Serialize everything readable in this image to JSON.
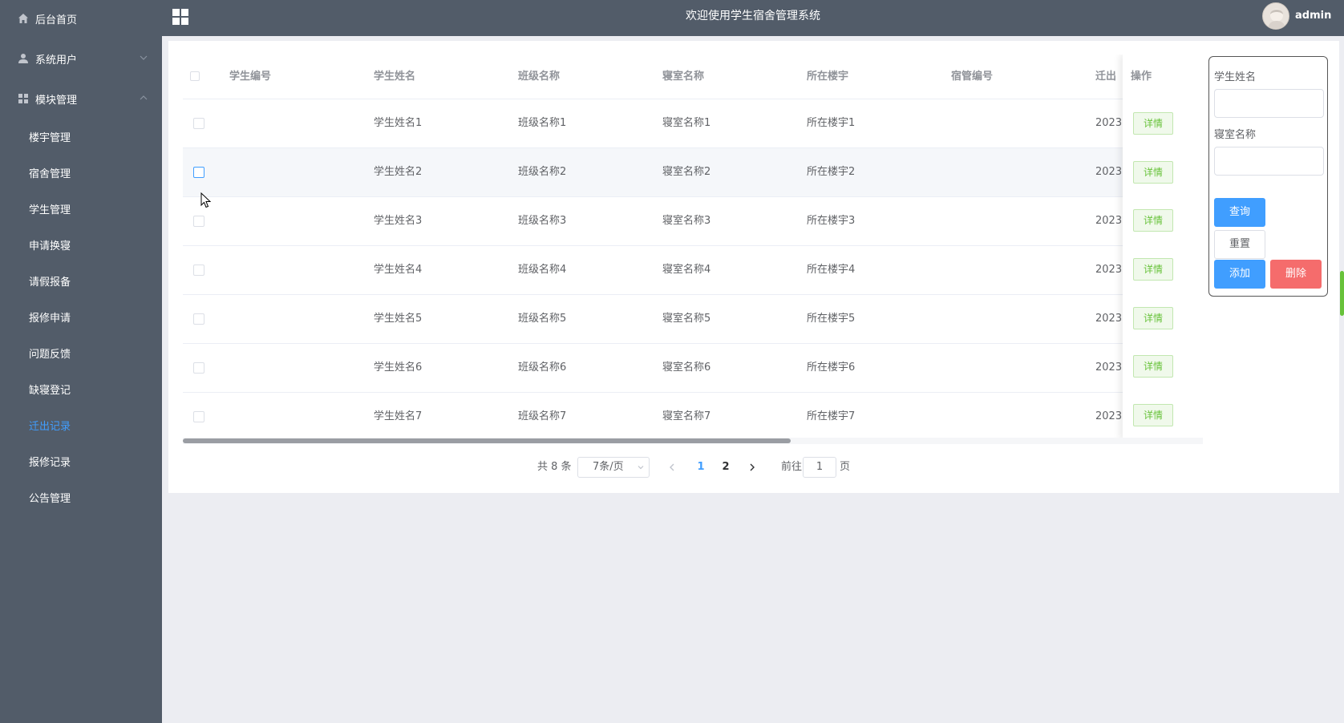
{
  "sidebar": {
    "items": [
      {
        "label": "后台首页",
        "icon": "home-icon"
      },
      {
        "label": "系统用户",
        "icon": "user-icon",
        "expanded": false
      },
      {
        "label": "模块管理",
        "icon": "grid-icon",
        "expanded": true
      }
    ],
    "submenu": [
      {
        "label": "楼宇管理"
      },
      {
        "label": "宿舍管理"
      },
      {
        "label": "学生管理"
      },
      {
        "label": "申请换寝"
      },
      {
        "label": "请假报备"
      },
      {
        "label": "报修申请"
      },
      {
        "label": "问题反馈"
      },
      {
        "label": "缺寝登记"
      },
      {
        "label": "迁出记录",
        "active": true
      },
      {
        "label": "报修记录"
      },
      {
        "label": "公告管理"
      }
    ]
  },
  "header": {
    "title": "欢迎使用学生宿舍管理系统",
    "username": "admin"
  },
  "table": {
    "columns": [
      "学生编号",
      "学生姓名",
      "班级名称",
      "寝室名称",
      "所在楼宇",
      "宿管编号",
      "迁出"
    ],
    "action_column": "操作",
    "detail_label": "详情",
    "rows": [
      {
        "student_no": "",
        "name": "学生姓名1",
        "class": "班级名称1",
        "room": "寝室名称1",
        "building": "所在楼宇1",
        "manager_no": "",
        "moveout": "2023"
      },
      {
        "student_no": "",
        "name": "学生姓名2",
        "class": "班级名称2",
        "room": "寝室名称2",
        "building": "所在楼宇2",
        "manager_no": "",
        "moveout": "2023"
      },
      {
        "student_no": "",
        "name": "学生姓名3",
        "class": "班级名称3",
        "room": "寝室名称3",
        "building": "所在楼宇3",
        "manager_no": "",
        "moveout": "2023"
      },
      {
        "student_no": "",
        "name": "学生姓名4",
        "class": "班级名称4",
        "room": "寝室名称4",
        "building": "所在楼宇4",
        "manager_no": "",
        "moveout": "2023"
      },
      {
        "student_no": "",
        "name": "学生姓名5",
        "class": "班级名称5",
        "room": "寝室名称5",
        "building": "所在楼宇5",
        "manager_no": "",
        "moveout": "2023"
      },
      {
        "student_no": "",
        "name": "学生姓名6",
        "class": "班级名称6",
        "room": "寝室名称6",
        "building": "所在楼宇6",
        "manager_no": "",
        "moveout": "2023"
      },
      {
        "student_no": "",
        "name": "学生姓名7",
        "class": "班级名称7",
        "room": "寝室名称7",
        "building": "所在楼宇7",
        "manager_no": "",
        "moveout": "2023"
      }
    ]
  },
  "pagination": {
    "total": "共 8 条",
    "page_size": "7条/页",
    "pages": [
      "1",
      "2"
    ],
    "current": "1",
    "goto_prefix": "前往",
    "goto_value": "1",
    "goto_suffix": "页"
  },
  "search": {
    "name_label": "学生姓名",
    "name_value": "",
    "room_label": "寝室名称",
    "room_value": "",
    "query_label": "查询",
    "reset_label": "重置",
    "add_label": "添加",
    "delete_label": "删除"
  },
  "colors": {
    "sidebar_bg": "#525c69",
    "accent": "#409eff",
    "success": "#67c23a",
    "danger": "#f56c6c"
  }
}
